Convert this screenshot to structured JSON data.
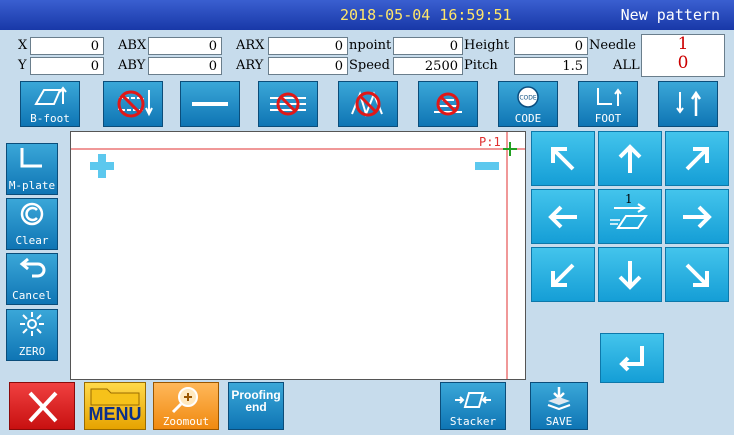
{
  "title": {
    "datetime": "2018-05-04 16:59:51",
    "pattern_name": "New pattern"
  },
  "readout": {
    "row1": [
      {
        "label": "X",
        "value": "0"
      },
      {
        "label": "ABX",
        "value": "0"
      },
      {
        "label": "ARX",
        "value": "0"
      },
      {
        "label": "npoint",
        "value": "0"
      },
      {
        "label": "Height",
        "value": "0"
      }
    ],
    "row2": [
      {
        "label": "Y",
        "value": "0"
      },
      {
        "label": "ABY",
        "value": "0"
      },
      {
        "label": "ARY",
        "value": "0"
      },
      {
        "label": "Speed",
        "value": "2500"
      },
      {
        "label": "Pitch",
        "value": "1.5"
      }
    ],
    "needle_label": "Needle",
    "all_label": "ALL",
    "needle_value": "1",
    "all_value": "0"
  },
  "toolbar": {
    "bfoot": "B-foot",
    "code": "CODE",
    "foot": "FOOT",
    "code_badge": "CODE"
  },
  "sidebar": {
    "mplate": "M-plate",
    "clear": "Clear",
    "cancel": "Cancel",
    "zero": "ZERO"
  },
  "canvas": {
    "point_label": "P:1"
  },
  "nav": {
    "step": "1"
  },
  "bottom": {
    "menu": "MENU",
    "zoomout": "Zoomout",
    "proofing": "Proofing end",
    "stacker": "Stacker",
    "save": "SAVE"
  },
  "colors": {
    "title_bg": "#1838a8",
    "title_text": "#ffe66a",
    "panel": "#c7dcec",
    "button": "#0f75b4",
    "needle_value": "#cc0000"
  }
}
